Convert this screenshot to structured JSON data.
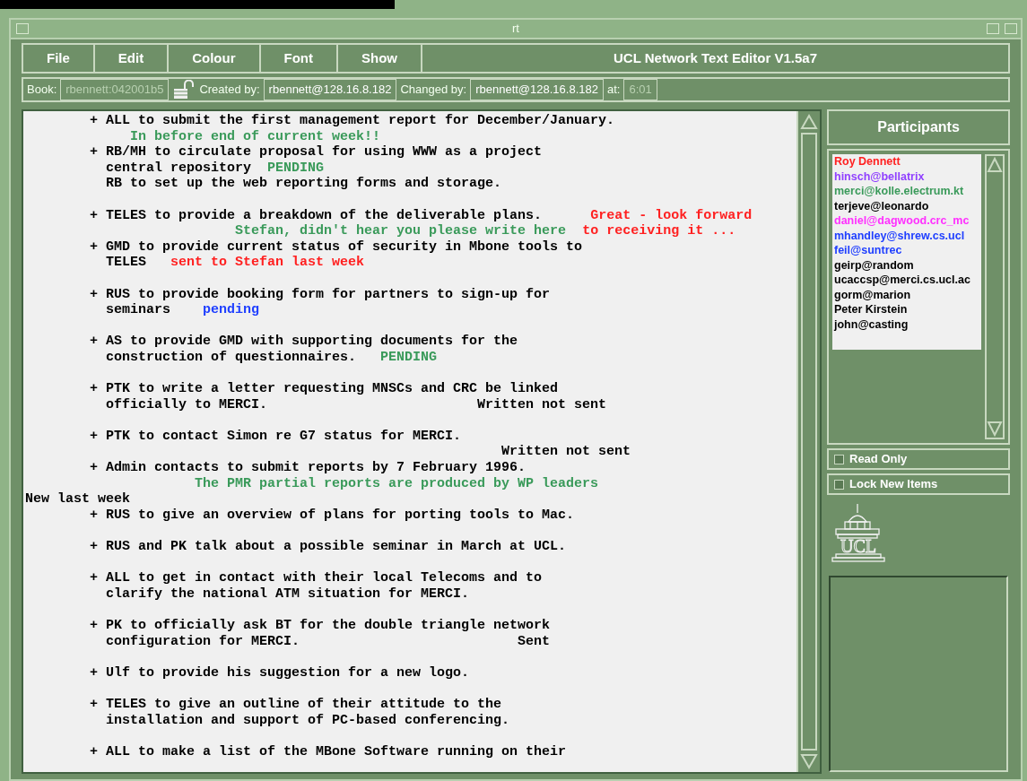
{
  "window": {
    "title": "rt"
  },
  "menu": [
    {
      "label": "File"
    },
    {
      "label": "Edit"
    },
    {
      "label": "Colour"
    },
    {
      "label": "Font"
    },
    {
      "label": "Show"
    }
  ],
  "app_title": "UCL Network Text Editor V1.5a7",
  "info_bar": [
    {
      "kind": "field",
      "label": "Book:",
      "value": "rbennett:042001b5",
      "disabled": true
    },
    {
      "kind": "lock",
      "locked": false
    },
    {
      "kind": "field",
      "label": "Created by:",
      "value": "rbennett@128.16.8.182",
      "disabled": false
    },
    {
      "kind": "field",
      "label": "Changed by:",
      "value": "rbennett@128.16.8.182",
      "disabled": false
    },
    {
      "kind": "field",
      "label": "at:",
      "value": "6:01",
      "disabled": true
    }
  ],
  "document": {
    "lines": [
      {
        "segments": [
          {
            "text": "        + ALL to submit the first management report for December/January.",
            "color": "#000000"
          }
        ]
      },
      {
        "segments": [
          {
            "text": "             In before end of current week!!",
            "color": "#3a9a5a"
          }
        ]
      },
      {
        "segments": [
          {
            "text": "        + RB/MH to circulate proposal for using WWW as a project",
            "color": "#000000"
          }
        ]
      },
      {
        "segments": [
          {
            "text": "          central repository",
            "color": "#000000"
          },
          {
            "text": "  PENDING",
            "color": "#3a9a5a"
          }
        ]
      },
      {
        "segments": [
          {
            "text": "          RB to set up the web reporting forms and storage.",
            "color": "#000000"
          }
        ]
      },
      {
        "space_before": true,
        "segments": [
          {
            "text": "        + TELES to provide a breakdown of the deliverable plans.",
            "color": "#000000"
          },
          {
            "text": "      Great - look forward",
            "color": "#ff2020"
          }
        ]
      },
      {
        "segments": [
          {
            "text": "                          Stefan, didn't hear you please write here",
            "color": "#3a9a5a"
          },
          {
            "text": "  to receiving it ...",
            "color": "#ff2020"
          }
        ]
      },
      {
        "segments": [
          {
            "text": "        + GMD to provide current status of security in Mbone tools to",
            "color": "#000000"
          }
        ]
      },
      {
        "segments": [
          {
            "text": "          TELES",
            "color": "#000000"
          },
          {
            "text": "   sent to Stefan last week",
            "color": "#ff2020"
          }
        ]
      },
      {
        "space_before": true,
        "segments": [
          {
            "text": "        + RUS to provide booking form for partners to sign-up for",
            "color": "#000000"
          }
        ]
      },
      {
        "segments": [
          {
            "text": "          seminars",
            "color": "#000000"
          },
          {
            "text": "    pending",
            "color": "#2040ff"
          }
        ]
      },
      {
        "space_before": true,
        "segments": [
          {
            "text": "        + AS to provide GMD with supporting documents for the",
            "color": "#000000"
          }
        ]
      },
      {
        "segments": [
          {
            "text": "          construction of questionnaires.",
            "color": "#000000"
          },
          {
            "text": "   PENDING",
            "color": "#3a9a5a"
          }
        ]
      },
      {
        "space_before": true,
        "segments": [
          {
            "text": "        + PTK to write a letter requesting MNSCs and CRC be linked",
            "color": "#000000"
          }
        ]
      },
      {
        "segments": [
          {
            "text": "          officially to MERCI.                          Written not sent",
            "color": "#000000"
          }
        ]
      },
      {
        "space_before": true,
        "segments": [
          {
            "text": "        + PTK to contact Simon re G7 status for MERCI.",
            "color": "#000000"
          }
        ]
      },
      {
        "segments": [
          {
            "text": "                                                           Written not sent",
            "color": "#000000"
          }
        ]
      },
      {
        "segments": [
          {
            "text": "        + Admin contacts to submit reports by 7 February 1996.",
            "color": "#000000"
          }
        ]
      },
      {
        "segments": [
          {
            "text": "                     The PMR partial reports are produced by WP leaders",
            "color": "#3a9a5a"
          }
        ]
      },
      {
        "segments": [
          {
            "text": "New last week",
            "color": "#000000"
          }
        ]
      },
      {
        "segments": [
          {
            "text": "        + RUS to give an overview of plans for porting tools to Mac.",
            "color": "#000000"
          }
        ]
      },
      {
        "space_before": true,
        "segments": [
          {
            "text": "        + RUS and PK talk about a possible seminar in March at UCL.",
            "color": "#000000"
          }
        ]
      },
      {
        "space_before": true,
        "segments": [
          {
            "text": "        + ALL to get in contact with their local Telecoms and to",
            "color": "#000000"
          }
        ]
      },
      {
        "segments": [
          {
            "text": "          clarify the national ATM situation for MERCI.",
            "color": "#000000"
          }
        ]
      },
      {
        "space_before": true,
        "segments": [
          {
            "text": "        + PK to officially ask BT for the double triangle network",
            "color": "#000000"
          }
        ]
      },
      {
        "segments": [
          {
            "text": "          configuration for MERCI.                           Sent",
            "color": "#000000"
          }
        ]
      },
      {
        "space_before": true,
        "segments": [
          {
            "text": "        + Ulf to provide his suggestion for a new logo.",
            "color": "#000000"
          }
        ]
      },
      {
        "space_before": true,
        "segments": [
          {
            "text": "        + TELES to give an outline of their attitude to the",
            "color": "#000000"
          }
        ]
      },
      {
        "segments": [
          {
            "text": "          installation and support of PC-based conferencing.",
            "color": "#000000"
          }
        ]
      },
      {
        "space_before": true,
        "segments": [
          {
            "text": "        + ALL to make a list of the MBone Software running on their",
            "color": "#000000"
          }
        ]
      }
    ]
  },
  "participants": {
    "title": "Participants",
    "items": [
      {
        "name": "Roy Dennett",
        "color": "#ff2020"
      },
      {
        "name": "hinsch@bellatrix",
        "color": "#9040ff"
      },
      {
        "name": "merci@kolle.electrum.kt",
        "color": "#3a9a5a"
      },
      {
        "name": "terjeve@leonardo",
        "color": "#000000"
      },
      {
        "name": "daniel@dagwood.crc_mc",
        "color": "#ff30ff"
      },
      {
        "name": "mhandley@shrew.cs.ucl",
        "color": "#2040ff"
      },
      {
        "name": "feil@suntrec",
        "color": "#2040ff"
      },
      {
        "name": "geirp@random",
        "color": "#000000"
      },
      {
        "name": "ucaccsp@merci.cs.ucl.ac",
        "color": "#000000"
      },
      {
        "name": "gorm@marion",
        "color": "#000000"
      },
      {
        "name": "Peter Kirstein",
        "color": "#000000"
      },
      {
        "name": "john@casting",
        "color": "#000000"
      }
    ]
  },
  "options": [
    {
      "label": "Read Only",
      "checked": false
    },
    {
      "label": "Lock New Items",
      "checked": false
    }
  ],
  "logo": {
    "text": "UCL"
  }
}
